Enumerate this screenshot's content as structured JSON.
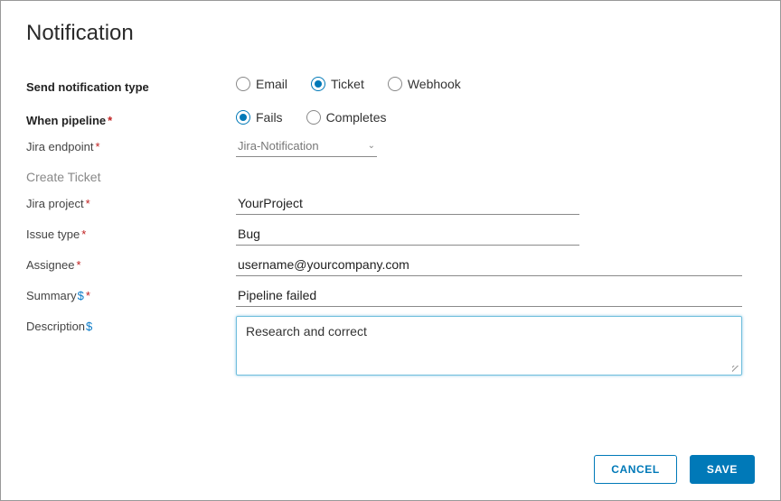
{
  "title": "Notification",
  "labels": {
    "send_type": "Send notification type",
    "when_pipeline": "When pipeline",
    "jira_endpoint": "Jira endpoint",
    "create_ticket": "Create Ticket",
    "jira_project": "Jira project",
    "issue_type": "Issue type",
    "assignee": "Assignee",
    "summary": "Summary",
    "description": "Description"
  },
  "notification_types": {
    "email": "Email",
    "ticket": "Ticket",
    "webhook": "Webhook",
    "selected": "ticket"
  },
  "when_pipeline": {
    "fails": "Fails",
    "completes": "Completes",
    "selected": "fails"
  },
  "fields": {
    "jira_endpoint": "Jira-Notification",
    "jira_project": "YourProject",
    "issue_type": "Bug",
    "assignee": "username@yourcompany.com",
    "summary": "Pipeline failed",
    "description": "Research and correct"
  },
  "buttons": {
    "cancel": "CANCEL",
    "save": "SAVE"
  }
}
